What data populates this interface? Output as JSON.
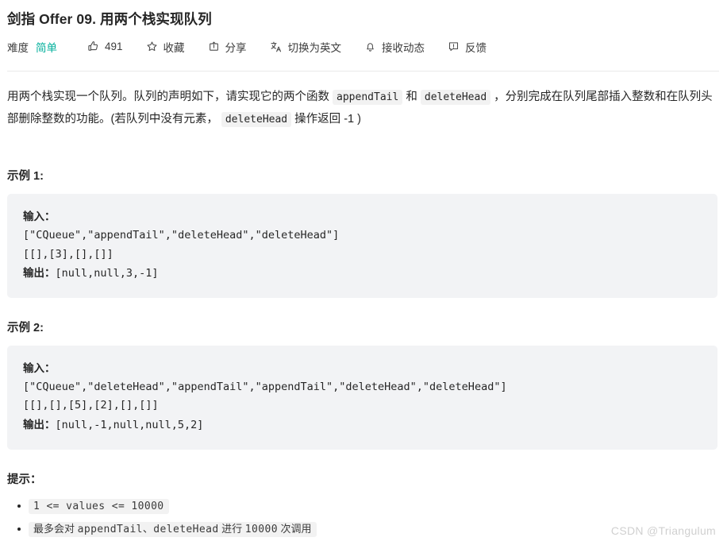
{
  "header": {
    "title": "剑指 Offer 09. 用两个栈实现队列",
    "toolbar": {
      "difficulty_label": "难度",
      "difficulty_value": "简单",
      "like_icon": "thumbs-up-icon",
      "like_count": "491",
      "favorite_icon": "star-icon",
      "favorite_label": "收藏",
      "share_icon": "share-icon",
      "share_label": "分享",
      "translate_icon": "translate-icon",
      "translate_label": "切换为英文",
      "subscribe_icon": "bell-icon",
      "subscribe_label": "接收动态",
      "feedback_icon": "feedback-icon",
      "feedback_label": "反馈"
    }
  },
  "description": {
    "part1": "用两个栈实现一个队列。队列的声明如下，请实现它的两个函数 ",
    "code1": "appendTail",
    "part2": " 和 ",
    "code2": "deleteHead",
    "part3": " ，分别完成在队列尾部插入整数和在队列头部删除整数的功能。(若队列中没有元素， ",
    "code3": "deleteHead",
    "part4": " 操作返回 -1 )"
  },
  "examples": [
    {
      "heading": "示例 1:",
      "input_label": "输入：",
      "input_lines": [
        "[\"CQueue\",\"appendTail\",\"deleteHead\",\"deleteHead\"]",
        "[[],[3],[],[]]"
      ],
      "output_label": "输出：",
      "output_value": "[null,null,3,-1]"
    },
    {
      "heading": "示例 2:",
      "input_label": "输入：",
      "input_lines": [
        "[\"CQueue\",\"deleteHead\",\"appendTail\",\"appendTail\",\"deleteHead\",\"deleteHead\"]",
        "[[],[],[5],[2],[],[]]"
      ],
      "output_label": "输出：",
      "output_value": "[null,-1,null,null,5,2]"
    }
  ],
  "hints": {
    "heading": "提示：",
    "items": [
      {
        "text": "1 <= values <= 10000"
      },
      {
        "seg1": "最多会对 ",
        "seg2": "appendTail、deleteHead",
        "seg3": " 进行 ",
        "seg4": "10000",
        "seg5": " 次调用"
      }
    ]
  },
  "watermark": "CSDN @Triangulum",
  "colors": {
    "accent_green": "#00af9b",
    "code_bg": "#f2f3f5",
    "inline_code_bg": "#f2f2f2",
    "text": "#262626",
    "divider": "#e9e9e9",
    "watermark": "#d0d0d0"
  }
}
